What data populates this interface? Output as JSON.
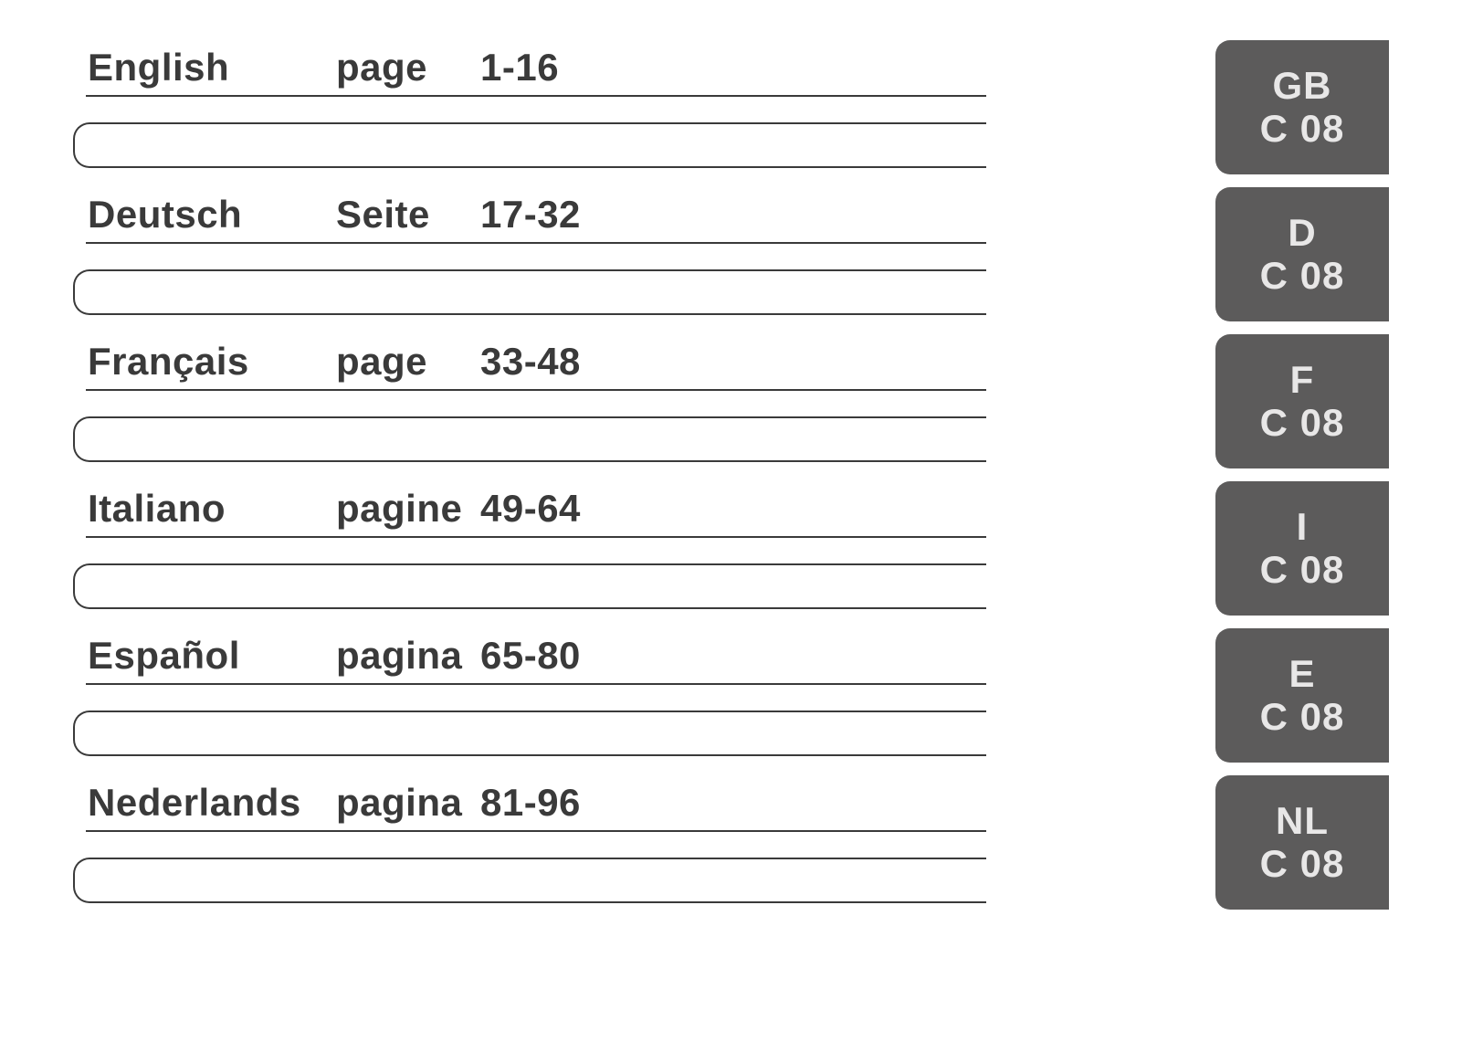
{
  "entries": [
    {
      "language": "English",
      "page_word": "page",
      "range": "1-16",
      "tab_code": "GB",
      "tab_sub": "C 08"
    },
    {
      "language": "Deutsch",
      "page_word": "Seite",
      "range": "17-32",
      "tab_code": "D",
      "tab_sub": "C 08"
    },
    {
      "language": "Français",
      "page_word": "page",
      "range": "33-48",
      "tab_code": "F",
      "tab_sub": "C 08"
    },
    {
      "language": "Italiano",
      "page_word": "pagine",
      "range": "49-64",
      "tab_code": "I",
      "tab_sub": "C 08"
    },
    {
      "language": "Español",
      "page_word": "pagina",
      "range": "65-80",
      "tab_code": "E",
      "tab_sub": "C 08"
    },
    {
      "language": "Nederlands",
      "page_word": "pagina",
      "range": "81-96",
      "tab_code": "NL",
      "tab_sub": "C 08"
    }
  ]
}
